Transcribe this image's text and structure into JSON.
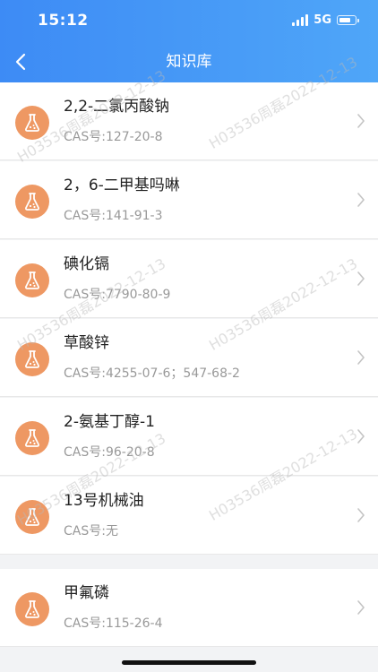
{
  "status_bar": {
    "time": "15:12",
    "network": "5G",
    "battery_level": 0.75
  },
  "navbar": {
    "title": "知识库",
    "back_icon": "chevron-left-icon"
  },
  "watermark": {
    "text": "H03536周磊2022-12-13"
  },
  "items": [
    {
      "name": "2,2-二氯丙酸钠",
      "cas": "CAS号:127-20-8"
    },
    {
      "name": "2，6-二甲基吗啉",
      "cas": "CAS号:141-91-3"
    },
    {
      "name": "碘化镉",
      "cas": "CAS号:7790-80-9"
    },
    {
      "name": "草酸锌",
      "cas": "CAS号:4255-07-6；547-68-2"
    },
    {
      "name": "2-氨基丁醇-1",
      "cas": "CAS号:96-20-8"
    },
    {
      "name": "13号机械油",
      "cas": "CAS号:无"
    },
    {
      "name": "甲氟磷",
      "cas": "CAS号:115-26-4"
    }
  ],
  "colors": {
    "header_start": "#3d8bf5",
    "header_end": "#4fa6f8",
    "icon_bg": "#ee9863"
  }
}
